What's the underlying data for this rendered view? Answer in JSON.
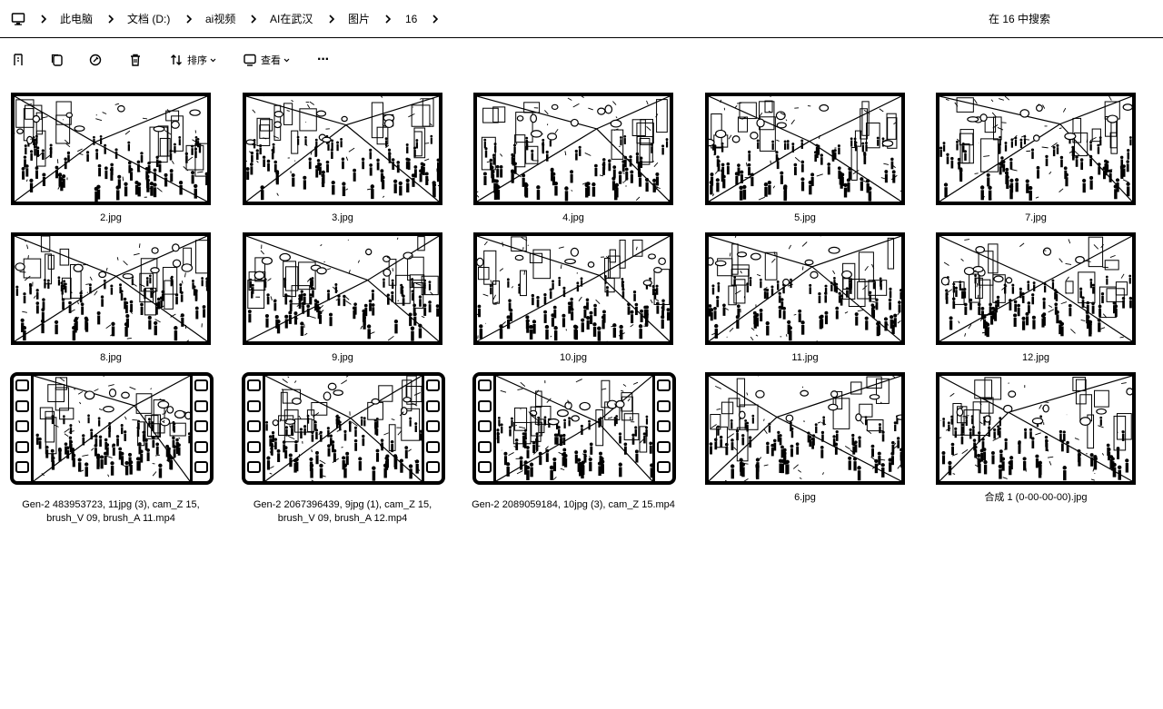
{
  "address": {
    "crumbs": [
      "此电脑",
      "文档 (D:)",
      "ai视频",
      "AI在武汉",
      "图片",
      "16"
    ],
    "search_placeholder": "在 16 中搜索"
  },
  "toolbar": {
    "sort_label": "排序",
    "view_label": "查看",
    "more_label": "···"
  },
  "files": [
    {
      "name": "2.jpg",
      "type": "image",
      "seed": 3
    },
    {
      "name": "3.jpg",
      "type": "image",
      "seed": 7
    },
    {
      "name": "4.jpg",
      "type": "image",
      "seed": 11
    },
    {
      "name": "5.jpg",
      "type": "image",
      "seed": 13
    },
    {
      "name": "7.jpg",
      "type": "image",
      "seed": 17
    },
    {
      "name": "8.jpg",
      "type": "image",
      "seed": 19
    },
    {
      "name": "9.jpg",
      "type": "image",
      "seed": 23
    },
    {
      "name": "10.jpg",
      "type": "image",
      "seed": 29
    },
    {
      "name": "11.jpg",
      "type": "image",
      "seed": 31
    },
    {
      "name": "12.jpg",
      "type": "image",
      "seed": 37
    },
    {
      "name": "Gen-2 483953723, 11jpg (3), cam_Z 15, brush_V 09, brush_A 11.mp4",
      "line1": "Gen-2 483953723, 11jpg (3), cam_Z 15,",
      "line2": "brush_V 09, brush_A 11.mp4",
      "type": "video",
      "seed": 41
    },
    {
      "name": "Gen-2 2067396439, 9jpg (1), cam_Z 15, brush_V 09, brush_A 12.mp4",
      "line1": "Gen-2 2067396439, 9jpg (1), cam_Z 15,",
      "line2": "brush_V 09, brush_A 12.mp4",
      "type": "video",
      "seed": 43
    },
    {
      "name": "Gen-2 2089059184, 10jpg (3), cam_Z 15.mp4",
      "line1": "Gen-2 2089059184, 10jpg (3), cam_Z 15.mp4",
      "line2": "",
      "type": "video",
      "seed": 47
    },
    {
      "name": "6.jpg",
      "type": "image",
      "seed": 53
    },
    {
      "name": "合成 1 (0-00-00-00).jpg",
      "type": "image",
      "seed": 59
    }
  ]
}
